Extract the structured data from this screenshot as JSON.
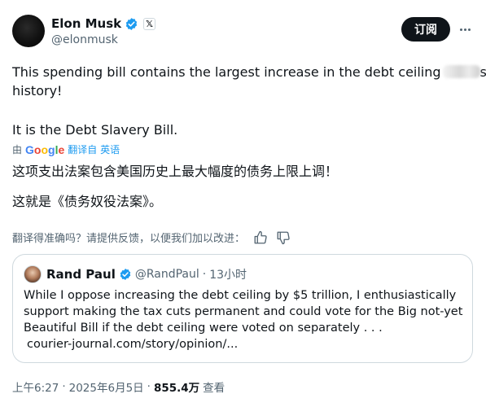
{
  "author": {
    "display_name": "Elon Musk",
    "handle": "@elonmusk",
    "verified_color": "#1d9bf0",
    "affiliate_badge": "𝕏"
  },
  "header": {
    "subscribe_label": "订阅",
    "more_icon": "more-horizontal-icon"
  },
  "tweet": {
    "line1": "This spending bill contains the largest increase in the debt ceiling",
    "line1_tail": "s",
    "line2": "history!",
    "line3": "It is the Debt Slavery Bill."
  },
  "translation": {
    "by_label": "由",
    "google_letters": [
      "G",
      "o",
      "o",
      "g",
      "l",
      "e"
    ],
    "translated_from": "翻译自 英语",
    "line1": "这项支出法案包含美国历史上最大幅度的债务上限上调！",
    "line2": "这就是《债务奴役法案》。",
    "feedback_prompt": "翻译得准确吗？请提供反馈，以便我们加以改进："
  },
  "quote": {
    "display_name": "Rand Paul",
    "handle": "@RandPaul",
    "separator": "·",
    "time": "13小时",
    "lines": [
      "While I oppose increasing the debt ceiling by $5 trillion, I enthusiastically",
      "support making the tax cuts permanent and could vote for the Big not-yet",
      "Beautiful Bill if the debt ceiling were voted on separately . . .",
      "courier-journal.com/story/opinion/..."
    ]
  },
  "footer": {
    "time": "上午6:27",
    "dot1": "·",
    "date": "2025年6月5日",
    "dot2": "·",
    "views": "855.4万",
    "views_label": "查看"
  },
  "colors": {
    "text": "#0f1419",
    "secondary": "#536471",
    "link": "#1d9bf0",
    "border": "#cfd9de"
  }
}
